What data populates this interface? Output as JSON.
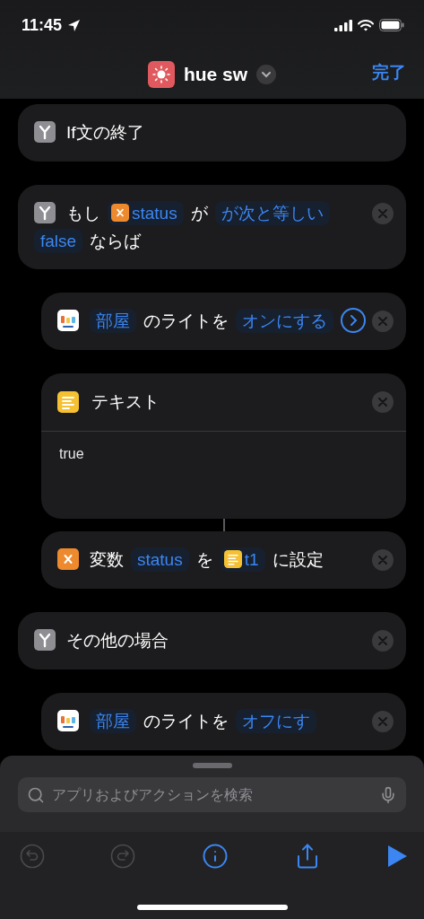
{
  "status_bar": {
    "time": "11:45"
  },
  "nav": {
    "title": "hue sw",
    "done": "完了"
  },
  "actions": [
    {
      "kind": "branch",
      "removable": false,
      "tokens": [
        {
          "kind": "text",
          "text": "If文の終了"
        }
      ]
    },
    {
      "kind": "branch",
      "removable": true,
      "tokens": [
        {
          "kind": "text",
          "text": "もし"
        },
        {
          "kind": "var",
          "text": "status"
        },
        {
          "kind": "text",
          "text": "が"
        },
        {
          "kind": "param",
          "text": "が次と等しい"
        },
        {
          "kind": "param",
          "text": "false"
        },
        {
          "kind": "text",
          "text": "ならば"
        }
      ],
      "children": [
        {
          "kind": "light",
          "removable": true,
          "tokens": [
            {
              "kind": "param",
              "text": "部屋"
            },
            {
              "kind": "text",
              "text": "のライトを"
            },
            {
              "kind": "param",
              "text": "オンにする"
            },
            {
              "kind": "chevron"
            }
          ]
        },
        {
          "kind": "text",
          "removable": true,
          "title": "テキスト",
          "body": "true"
        },
        {
          "kind": "set_variable",
          "removable": true,
          "linked": true,
          "tokens": [
            {
              "kind": "text",
              "text": "変数"
            },
            {
              "kind": "param",
              "text": "status"
            },
            {
              "kind": "text",
              "text": "を"
            },
            {
              "kind": "textvar",
              "text": "t1"
            },
            {
              "kind": "text",
              "text": "に設定"
            }
          ]
        }
      ]
    },
    {
      "kind": "branch",
      "removable": true,
      "tokens": [
        {
          "kind": "text",
          "text": "その他の場合"
        }
      ],
      "children": [
        {
          "kind": "light",
          "removable": true,
          "tokens": [
            {
              "kind": "param",
              "text": "部屋"
            },
            {
              "kind": "text",
              "text": "のライトを"
            },
            {
              "kind": "param",
              "text": "オフにす"
            }
          ]
        }
      ]
    }
  ],
  "sheet": {
    "search": {
      "placeholder": "アプリおよびアクションを検索"
    },
    "toolbar": [
      {
        "kind": "undo",
        "disabled": true
      },
      {
        "kind": "redo",
        "disabled": true
      },
      {
        "kind": "info",
        "disabled": false
      },
      {
        "kind": "share",
        "disabled": false
      },
      {
        "kind": "play",
        "disabled": false
      }
    ]
  }
}
